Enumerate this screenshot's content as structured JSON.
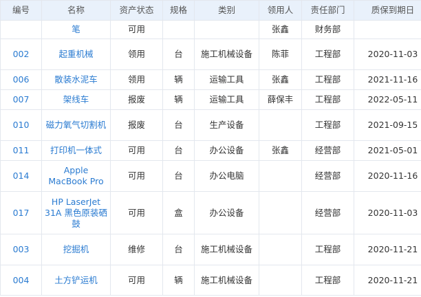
{
  "table": {
    "headers": [
      "编号",
      "名称",
      "资产状态",
      "规格",
      "类别",
      "领用人",
      "责任部门",
      "质保到期日"
    ],
    "rows": [
      {
        "id": "",
        "name": "笔",
        "status": "可用",
        "spec": "",
        "category": "",
        "user": "张鑫",
        "dept": "财务部",
        "warranty": ""
      },
      {
        "id": "002",
        "name": "起重机械",
        "status": "领用",
        "spec": "台",
        "category": "施工机械设备",
        "user": "陈菲",
        "dept": "工程部",
        "warranty": "2020-11-03"
      },
      {
        "id": "006",
        "name": "散装水泥车",
        "status": "领用",
        "spec": "辆",
        "category": "运输工具",
        "user": "张鑫",
        "dept": "工程部",
        "warranty": "2021-11-16"
      },
      {
        "id": "007",
        "name": "架线车",
        "status": "报废",
        "spec": "辆",
        "category": "运输工具",
        "user": "薛保丰",
        "dept": "工程部",
        "warranty": "2022-05-11"
      },
      {
        "id": "010",
        "name": "磁力氧气切割机",
        "status": "报废",
        "spec": "台",
        "category": "生产设备",
        "user": "",
        "dept": "工程部",
        "warranty": "2021-09-15"
      },
      {
        "id": "011",
        "name": "打印机一体式",
        "status": "可用",
        "spec": "台",
        "category": "办公设备",
        "user": "张鑫",
        "dept": "经营部",
        "warranty": "2021-05-01"
      },
      {
        "id": "014",
        "name": "Apple MacBook Pro",
        "status": "可用",
        "spec": "台",
        "category": "办公电脑",
        "user": "",
        "dept": "经营部",
        "warranty": "2020-11-16"
      },
      {
        "id": "017",
        "name": "HP LaserJet 31A 黑色原装硒鼓",
        "status": "可用",
        "spec": "盒",
        "category": "办公设备",
        "user": "",
        "dept": "经营部",
        "warranty": "2020-11-03"
      },
      {
        "id": "003",
        "name": "挖掘机",
        "status": "维修",
        "spec": "台",
        "category": "施工机械设备",
        "user": "",
        "dept": "工程部",
        "warranty": "2020-11-21"
      },
      {
        "id": "004",
        "name": "土方铲运机",
        "status": "可用",
        "spec": "辆",
        "category": "施工机械设备",
        "user": "",
        "dept": "工程部",
        "warranty": "2020-11-21"
      }
    ]
  }
}
